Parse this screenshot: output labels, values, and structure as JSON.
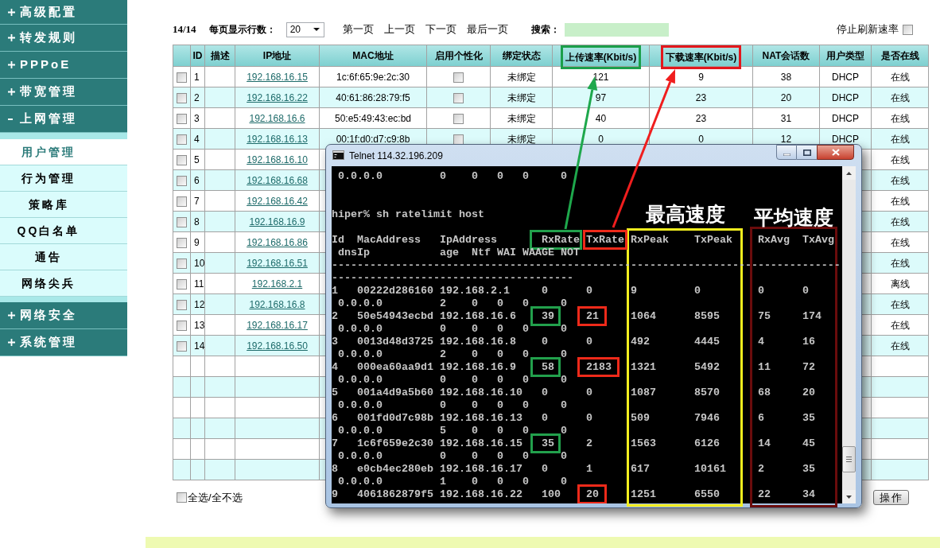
{
  "sidebar": {
    "items": [
      {
        "label": "高级配置",
        "expanded": false
      },
      {
        "label": "转发规则",
        "expanded": false
      },
      {
        "label": "PPPoE",
        "expanded": false
      },
      {
        "label": "带宽管理",
        "expanded": false
      },
      {
        "label": "上网管理",
        "expanded": true,
        "children": [
          {
            "label": "用户管理",
            "selected": true
          },
          {
            "label": "行为管理",
            "selected": false
          },
          {
            "label": "策略库",
            "selected": false
          },
          {
            "label": "QQ白名单",
            "selected": false
          },
          {
            "label": "通告",
            "selected": false
          },
          {
            "label": "网络尖兵",
            "selected": false
          }
        ]
      },
      {
        "label": "网络安全",
        "expanded": false
      },
      {
        "label": "系统管理",
        "expanded": false
      }
    ]
  },
  "toolbar": {
    "page_count": "14/14",
    "rows_per_page_label": "每页显示行数：",
    "rows_per_page": "20",
    "pager": [
      "第一页",
      "上一页",
      "下一页",
      "最后一页"
    ],
    "search_label": "搜索：",
    "stop_refresh_label": "停止刷新速率",
    "stop_refresh_checked": false
  },
  "table": {
    "columns": [
      {
        "label": "ID"
      },
      {
        "label": "描述"
      },
      {
        "label": "IP地址"
      },
      {
        "label": "MAC地址"
      },
      {
        "label": "启用个性化"
      },
      {
        "label": "绑定状态"
      },
      {
        "label": "上传速率(Kbit/s)",
        "color": "#1b9f4a"
      },
      {
        "label": "下载速率(Kbit/s)",
        "color": "#e3171c"
      },
      {
        "label": "NAT会话数"
      },
      {
        "label": "用户类型"
      },
      {
        "label": "是否在线"
      }
    ],
    "rows": [
      {
        "checked": false,
        "id": "1",
        "ip": "192.168.16.15",
        "mac": "1c:6f:65:9e:2c:30",
        "personalization": false,
        "binding": "未绑定",
        "upload": "121",
        "download": "9",
        "nat_sessions": "38",
        "user_type": "DHCP",
        "online": "在线"
      },
      {
        "checked": false,
        "id": "2",
        "ip": "192.168.16.22",
        "mac": "40:61:86:28:79:f5",
        "personalization": false,
        "binding": "未绑定",
        "upload": "97",
        "download": "23",
        "nat_sessions": "20",
        "user_type": "DHCP",
        "online": "在线"
      },
      {
        "checked": false,
        "id": "3",
        "ip": "192.168.16.6",
        "mac": "50:e5:49:43:ec:bd",
        "personalization": false,
        "binding": "未绑定",
        "upload": "40",
        "download": "23",
        "nat_sessions": "31",
        "user_type": "DHCP",
        "online": "在线"
      },
      {
        "checked": false,
        "id": "4",
        "ip": "192.168.16.13",
        "mac": "00:1f:d0:d7:c9:8b",
        "personalization": false,
        "binding": "未绑定",
        "upload": "0",
        "download": "0",
        "nat_sessions": "12",
        "user_type": "DHCP",
        "online": "在线"
      },
      {
        "checked": false,
        "id": "5",
        "ip": "192.168.16.10",
        "online": "在线"
      },
      {
        "checked": false,
        "id": "6",
        "ip": "192.168.16.68",
        "online": "在线"
      },
      {
        "checked": false,
        "id": "7",
        "ip": "192.168.16.42",
        "online": "在线"
      },
      {
        "checked": false,
        "id": "8",
        "ip": "192.168.16.9",
        "online": "在线"
      },
      {
        "checked": false,
        "id": "9",
        "ip": "192.168.16.86",
        "online": "在线"
      },
      {
        "checked": false,
        "id": "10",
        "ip": "192.168.16.51",
        "online": "在线"
      },
      {
        "checked": false,
        "id": "11",
        "ip": "192.168.2.1",
        "online": "离线"
      },
      {
        "checked": false,
        "id": "12",
        "ip": "192.168.16.8",
        "online": "在线"
      },
      {
        "checked": false,
        "id": "13",
        "ip": "192.168.16.17",
        "online": "在线"
      },
      {
        "checked": false,
        "id": "14",
        "ip": "192.168.16.50",
        "online": "在线"
      }
    ]
  },
  "footer": {
    "select_all_checked": false,
    "select_all_label": "全选/全不选",
    "action_button": "操作"
  },
  "terminal": {
    "title": "Telnet 114.32.196.209",
    "previous_output": [
      "0.0.0.0",
      "0",
      "0",
      "0",
      "0",
      "0"
    ],
    "command": "hiper% sh ratelimit host",
    "header_line_1": [
      {
        "text": "Id"
      },
      {
        "text": "MacAddress"
      },
      {
        "text": "IpAddress"
      },
      {
        "text": "RxRate",
        "color": "#22a04c"
      },
      {
        "text": "TxRate",
        "color": "#ee2a1a"
      },
      {
        "text": "RxPeak"
      },
      {
        "text": "TxPeak"
      },
      {
        "text": "RxAvg"
      },
      {
        "text": "TxAvg"
      }
    ],
    "header_line_2": [
      "dnsIp",
      "age",
      "Ntf",
      "WAI",
      "WAAGE",
      "NOT"
    ],
    "separators": [
      "--------------------------------------------------------------------------------",
      "--------------------------------------"
    ],
    "records": [
      {
        "line_1": [
          {
            "text": "1"
          },
          {
            "text": "00222d286160"
          },
          {
            "text": "192.168.2.1"
          },
          {
            "text": "0"
          },
          {
            "text": "0"
          },
          {
            "text": "9"
          },
          {
            "text": "0"
          },
          {
            "text": "0"
          },
          {
            "text": "0"
          }
        ],
        "line_2": [
          "0.0.0.0",
          "2",
          "0",
          "0",
          "0",
          "0"
        ]
      },
      {
        "line_1": [
          {
            "text": "2"
          },
          {
            "text": "50e54943ecbd"
          },
          {
            "text": "192.168.16.6"
          },
          {
            "text": "39",
            "color": "#22a04c"
          },
          {
            "text": "21",
            "color": "#ee2a1a"
          },
          {
            "text": "1064"
          },
          {
            "text": "8595"
          },
          {
            "text": "75"
          },
          {
            "text": "174"
          }
        ],
        "line_2": [
          "0.0.0.0",
          "0",
          "0",
          "0",
          "0",
          "0"
        ]
      },
      {
        "line_1": [
          {
            "text": "3"
          },
          {
            "text": "0013d48d3725"
          },
          {
            "text": "192.168.16.8"
          },
          {
            "text": "0"
          },
          {
            "text": "0"
          },
          {
            "text": "492"
          },
          {
            "text": "4445"
          },
          {
            "text": "4"
          },
          {
            "text": "16"
          }
        ],
        "line_2": [
          "0.0.0.0",
          "2",
          "0",
          "0",
          "0",
          "0"
        ]
      },
      {
        "line_1": [
          {
            "text": "4"
          },
          {
            "text": "000ea60aa9d1"
          },
          {
            "text": "192.168.16.9"
          },
          {
            "text": "58",
            "color": "#22a04c"
          },
          {
            "text": "2183",
            "color": "#ee2a1a"
          },
          {
            "text": "1321"
          },
          {
            "text": "5492"
          },
          {
            "text": "11"
          },
          {
            "text": "72"
          }
        ],
        "line_2": [
          "0.0.0.0",
          "0",
          "0",
          "0",
          "0",
          "0"
        ]
      },
      {
        "line_1": [
          {
            "text": "5"
          },
          {
            "text": "001a4d9a5b60"
          },
          {
            "text": "192.168.16.10"
          },
          {
            "text": "0"
          },
          {
            "text": "0"
          },
          {
            "text": "1087"
          },
          {
            "text": "8570"
          },
          {
            "text": "68"
          },
          {
            "text": "20"
          }
        ],
        "line_2": [
          "0.0.0.0",
          "0",
          "0",
          "0",
          "0",
          "0"
        ]
      },
      {
        "line_1": [
          {
            "text": "6"
          },
          {
            "text": "001fd0d7c98b"
          },
          {
            "text": "192.168.16.13"
          },
          {
            "text": "0"
          },
          {
            "text": "0"
          },
          {
            "text": "509"
          },
          {
            "text": "7946"
          },
          {
            "text": "6"
          },
          {
            "text": "35"
          }
        ],
        "line_2": [
          "0.0.0.0",
          "5",
          "0",
          "0",
          "0",
          "0"
        ]
      },
      {
        "line_1": [
          {
            "text": "7"
          },
          {
            "text": "1c6f659e2c30"
          },
          {
            "text": "192.168.16.15"
          },
          {
            "text": "35",
            "color": "#22a04c"
          },
          {
            "text": "2"
          },
          {
            "text": "1563"
          },
          {
            "text": "6126"
          },
          {
            "text": "14"
          },
          {
            "text": "45"
          }
        ],
        "line_2": [
          "0.0.0.0",
          "0",
          "0",
          "0",
          "0",
          "0"
        ]
      },
      {
        "line_1": [
          {
            "text": "8"
          },
          {
            "text": "e0cb4ec280eb"
          },
          {
            "text": "192.168.16.17"
          },
          {
            "text": "0"
          },
          {
            "text": "1"
          },
          {
            "text": "617"
          },
          {
            "text": "10161"
          },
          {
            "text": "2"
          },
          {
            "text": "35"
          }
        ],
        "line_2": [
          "0.0.0.0",
          "1",
          "0",
          "0",
          "0",
          "0"
        ]
      },
      {
        "line_1": [
          {
            "text": "9"
          },
          {
            "text": "4061862879f5"
          },
          {
            "text": "192.168.16.22"
          },
          {
            "text": "100"
          },
          {
            "text": "20",
            "color": "#ee2a1a"
          },
          {
            "text": "1251"
          },
          {
            "text": "6550"
          },
          {
            "text": "22"
          },
          {
            "text": "34"
          }
        ]
      }
    ],
    "frames": [
      {
        "label": "最高速度",
        "color": "#f2ee1e"
      },
      {
        "label": "平均速度",
        "color": "#6a0c0c"
      }
    ]
  }
}
